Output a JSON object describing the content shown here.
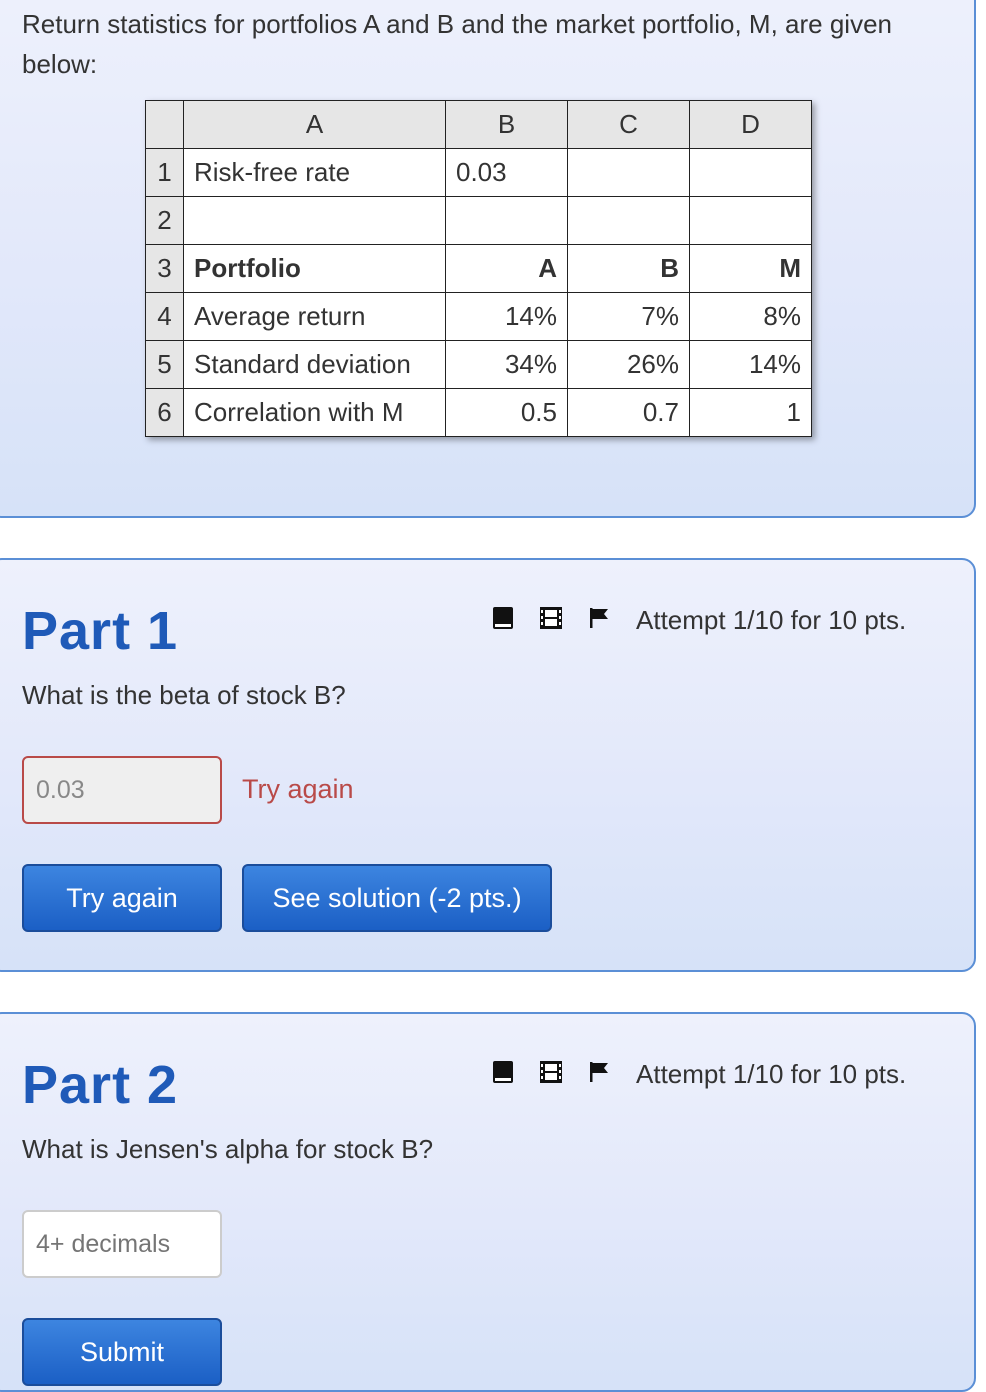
{
  "intro": {
    "text": "Return statistics for portfolios A and B and the market portfolio, M, are given below:"
  },
  "spreadsheet": {
    "column_headers": [
      "A",
      "B",
      "C",
      "D"
    ],
    "rows": [
      {
        "num": "1",
        "a": "Risk-free rate",
        "b": "0.03",
        "c": "",
        "d": ""
      },
      {
        "num": "2",
        "a": "",
        "b": "",
        "c": "",
        "d": ""
      },
      {
        "num": "3",
        "a": "Portfolio",
        "b": "A",
        "c": "B",
        "d": "M"
      },
      {
        "num": "4",
        "a": "Average return",
        "b": "14%",
        "c": "7%",
        "d": "8%"
      },
      {
        "num": "5",
        "a": "Standard deviation",
        "b": "34%",
        "c": "26%",
        "d": "14%"
      },
      {
        "num": "6",
        "a": "Correlation with M",
        "b": "0.5",
        "c": "0.7",
        "d": "1"
      }
    ]
  },
  "parts": [
    {
      "title": "Part 1",
      "attempt": "Attempt 1/10 for 10 pts.",
      "question": "What is the beta of stock B?",
      "input": {
        "value": "0.03",
        "placeholder": ""
      },
      "feedback": "Try again",
      "buttons": {
        "primary": "Try again",
        "solution": "See solution (-2 pts.)"
      },
      "icons": [
        "book-icon",
        "film-icon",
        "flag-icon"
      ]
    },
    {
      "title": "Part 2",
      "attempt": "Attempt 1/10 for 10 pts.",
      "question": "What is Jensen's alpha for stock B?",
      "input": {
        "value": "",
        "placeholder": "4+ decimals"
      },
      "buttons": {
        "primary": "Submit"
      },
      "icons": [
        "book-icon",
        "film-icon",
        "flag-icon"
      ]
    }
  ],
  "colors": {
    "accent_blue": "#1f5ab8",
    "button_blue": "#2a6fd4",
    "error_red": "#b94a48",
    "panel_border": "#5b8fd6"
  }
}
